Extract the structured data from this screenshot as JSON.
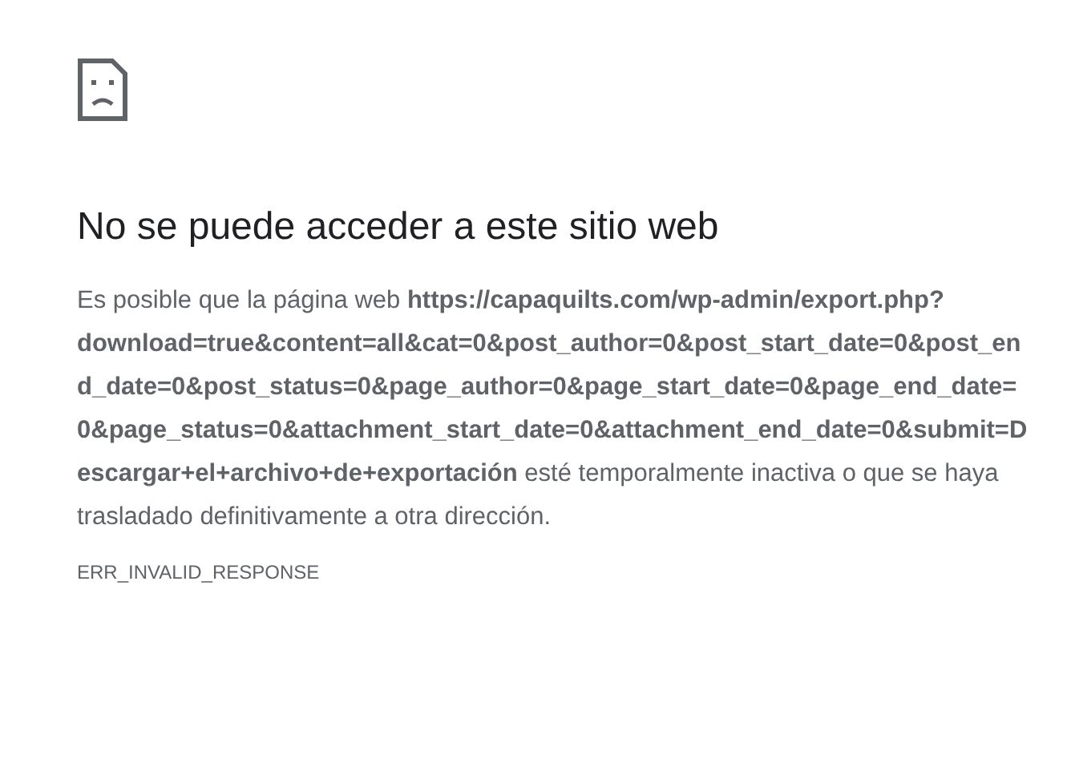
{
  "heading": "No se puede acceder a este sitio web",
  "message": "Es posible que la página web **https://capaquilts.com/wp-admin/export.php?download=true&content=all&cat=0&post_author=0&post_start_date=0&post_end_date=0&post_status=0&page_author=0&page_start_date=0&page_end_date=0&page_status=0&attachment_start_date=0&attachment_end_date=0&submit=Descargar+el+archivo+de+exportación** esté temporalmente inactiva o que se haya trasladado definitivamente a otra dirección.",
  "error_code": "ERR_INVALID_RESPONSE"
}
